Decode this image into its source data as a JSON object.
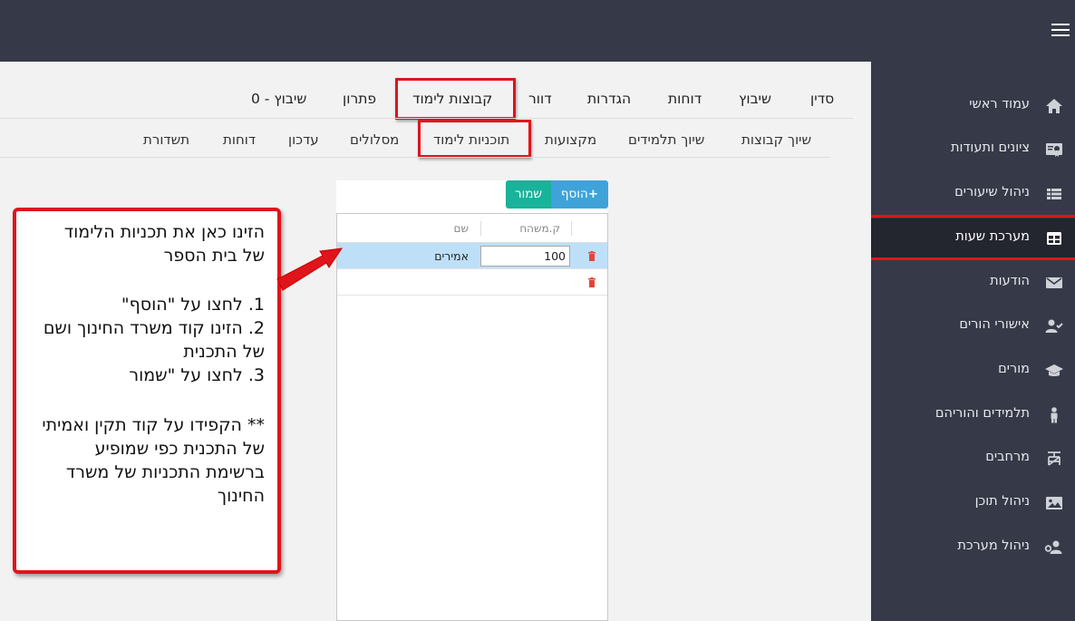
{
  "colors": {
    "red_highlight": "#e0141b",
    "dark_nav": "#363a48",
    "add_blue": "#3fa3d9",
    "save_teal": "#19b29a",
    "row_selected": "#bde0f8"
  },
  "sidebar": {
    "items": [
      {
        "label": "עמוד ראשי",
        "icon": "home-icon"
      },
      {
        "label": "ציונים ותעודות",
        "icon": "certificate-icon"
      },
      {
        "label": "ניהול שיעורים",
        "icon": "list-icon"
      },
      {
        "label": "מערכת שעות",
        "icon": "table-icon"
      },
      {
        "label": "הודעות",
        "icon": "envelope-icon"
      },
      {
        "label": "אישורי הורים",
        "icon": "user-check-icon"
      },
      {
        "label": "מורים",
        "icon": "graduation-cap-icon"
      },
      {
        "label": "תלמידים והוריהם",
        "icon": "child-icon"
      },
      {
        "label": "מרחבים",
        "icon": "room-icon"
      },
      {
        "label": "ניהול תוכן",
        "icon": "image-icon"
      },
      {
        "label": "ניהול מערכת",
        "icon": "user-cog-icon"
      }
    ]
  },
  "main_tabs": [
    "סדין",
    "שיבוץ",
    "דוחות",
    "הגדרות",
    "דוור",
    "קבוצות לימוד",
    "פתרון",
    "שיבוץ - 0"
  ],
  "sub_tabs": [
    "שיוך קבוצות",
    "שיוך תלמידים",
    "מקצועות",
    "תוכניות לימוד",
    "מסלולים",
    "עדכון",
    "דוחות",
    "תשדורת"
  ],
  "toolbar": {
    "add_label": "הוסף",
    "save_label": "שמור"
  },
  "grid": {
    "columns": [
      "ק.משהח",
      "שם"
    ],
    "rows": [
      {
        "code": "100",
        "name": "אמירים"
      }
    ]
  },
  "callout": {
    "lines": [
      "הזינו כאן את תכניות הלימוד",
      "של בית הספר",
      "1. לחצו על \"הוסף\"",
      "2. הזינו קוד משרד החינוך ושם",
      "של התכנית",
      "3. לחצו על \"שמור",
      "** הקפידו על קוד תקין ואמיתי",
      "של התכנית כפי שמופיע",
      "ברשימת התכניות של משרד",
      "החינוך"
    ]
  }
}
